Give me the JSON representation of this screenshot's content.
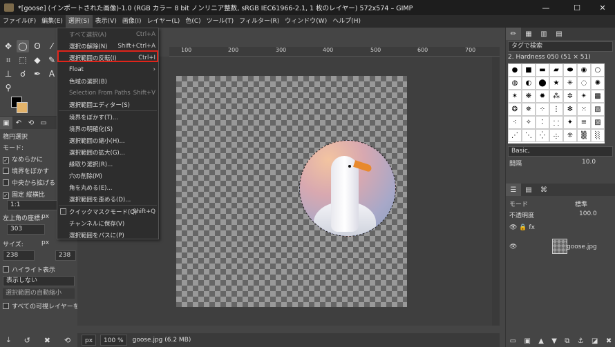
{
  "window": {
    "title": "*[goose] (インポートされた画像)-1.0 (RGB カラー 8 bit ノンリニア整数, sRGB IEC61966-2.1, 1 枚のレイヤー) 572x574 – GIMP",
    "minimize": "—",
    "maximize": "☐",
    "close": "✕"
  },
  "menubar": [
    "ファイル(F)",
    "編集(E)",
    "選択(S)",
    "表示(V)",
    "画像(I)",
    "レイヤー(L)",
    "色(C)",
    "ツール(T)",
    "フィルター(R)",
    "ウィンドウ(W)",
    "ヘルプ(H)"
  ],
  "select_menu": [
    {
      "label": "すべて選択(A)",
      "shortcut": "Ctrl+A",
      "disabled": true
    },
    {
      "label": "選択の解除(N)",
      "shortcut": "Shift+Ctrl+A",
      "disabled": false
    },
    {
      "label": "選択範囲の反転(I)",
      "shortcut": "Ctrl+I",
      "disabled": false,
      "highlighted": true
    },
    {
      "label": "Float",
      "shortcut": "",
      "disabled": false,
      "submenu": true
    },
    {
      "label": "色域の選択(B)",
      "shortcut": "",
      "disabled": false
    },
    {
      "label": "Selection From Paths",
      "shortcut": "Shift+V",
      "disabled": true
    },
    {
      "label": "選択範囲エディター(S)",
      "shortcut": "",
      "disabled": false
    },
    {
      "label": "境界をぼかす(T)...",
      "shortcut": "",
      "disabled": false
    },
    {
      "label": "境界の明確化(S)",
      "shortcut": "",
      "disabled": false
    },
    {
      "label": "選択範囲の縮小(H)...",
      "shortcut": "",
      "disabled": false
    },
    {
      "label": "選択範囲の拡大(G)...",
      "shortcut": "",
      "disabled": false
    },
    {
      "label": "縁取り選択(R)...",
      "shortcut": "",
      "disabled": false
    },
    {
      "label": "穴の削除(M)",
      "shortcut": "",
      "disabled": false
    },
    {
      "label": "角を丸める(E)...",
      "shortcut": "",
      "disabled": false
    },
    {
      "label": "選択範囲を歪める(D)...",
      "shortcut": "",
      "disabled": false
    },
    {
      "label": "クイックマスクモード(Q)",
      "shortcut": "Shift+Q",
      "disabled": false,
      "checkbox": true
    },
    {
      "label": "チャンネルに保存(V)",
      "shortcut": "",
      "disabled": false
    },
    {
      "label": "選択範囲をパスに(P)",
      "shortcut": "",
      "disabled": false
    }
  ],
  "tool_options": {
    "title": "楕円選択",
    "mode_label": "モード:",
    "antialias": "なめらかに",
    "feather": "境界をぼかす",
    "expand_center": "中央から拡げる",
    "fixed_label": "固定",
    "fixed_value": "縦横比",
    "ratio": "1:1",
    "position_label": "左上角の座標:",
    "position_unit": "px",
    "position_x": "303",
    "size_label": "サイズ:",
    "size_unit": "px",
    "size_w": "238",
    "size_h": "238",
    "highlight": "ハイライト表示",
    "guides": "表示しない",
    "auto_shrink": "選択範囲の自動縮小",
    "merged": "すべての可視レイヤーを対象"
  },
  "ruler": [
    "100",
    "200",
    "300",
    "400",
    "500",
    "600",
    "700"
  ],
  "statusbar": {
    "unit": "px",
    "zoom": "100 %",
    "info": "goose.jpg (6.2 MB)"
  },
  "right_dock": {
    "brush_filter_placeholder": "タグで検索",
    "brush_name": "2. Hardness 050 (51 × 51)",
    "preset": "Basic,",
    "spacing_label": "間隔",
    "spacing_value": "10.0",
    "mode_label": "モード",
    "mode_value": "標準",
    "opacity_label": "不透明度",
    "opacity_value": "100.0",
    "layer_name": "goose.jpg"
  }
}
